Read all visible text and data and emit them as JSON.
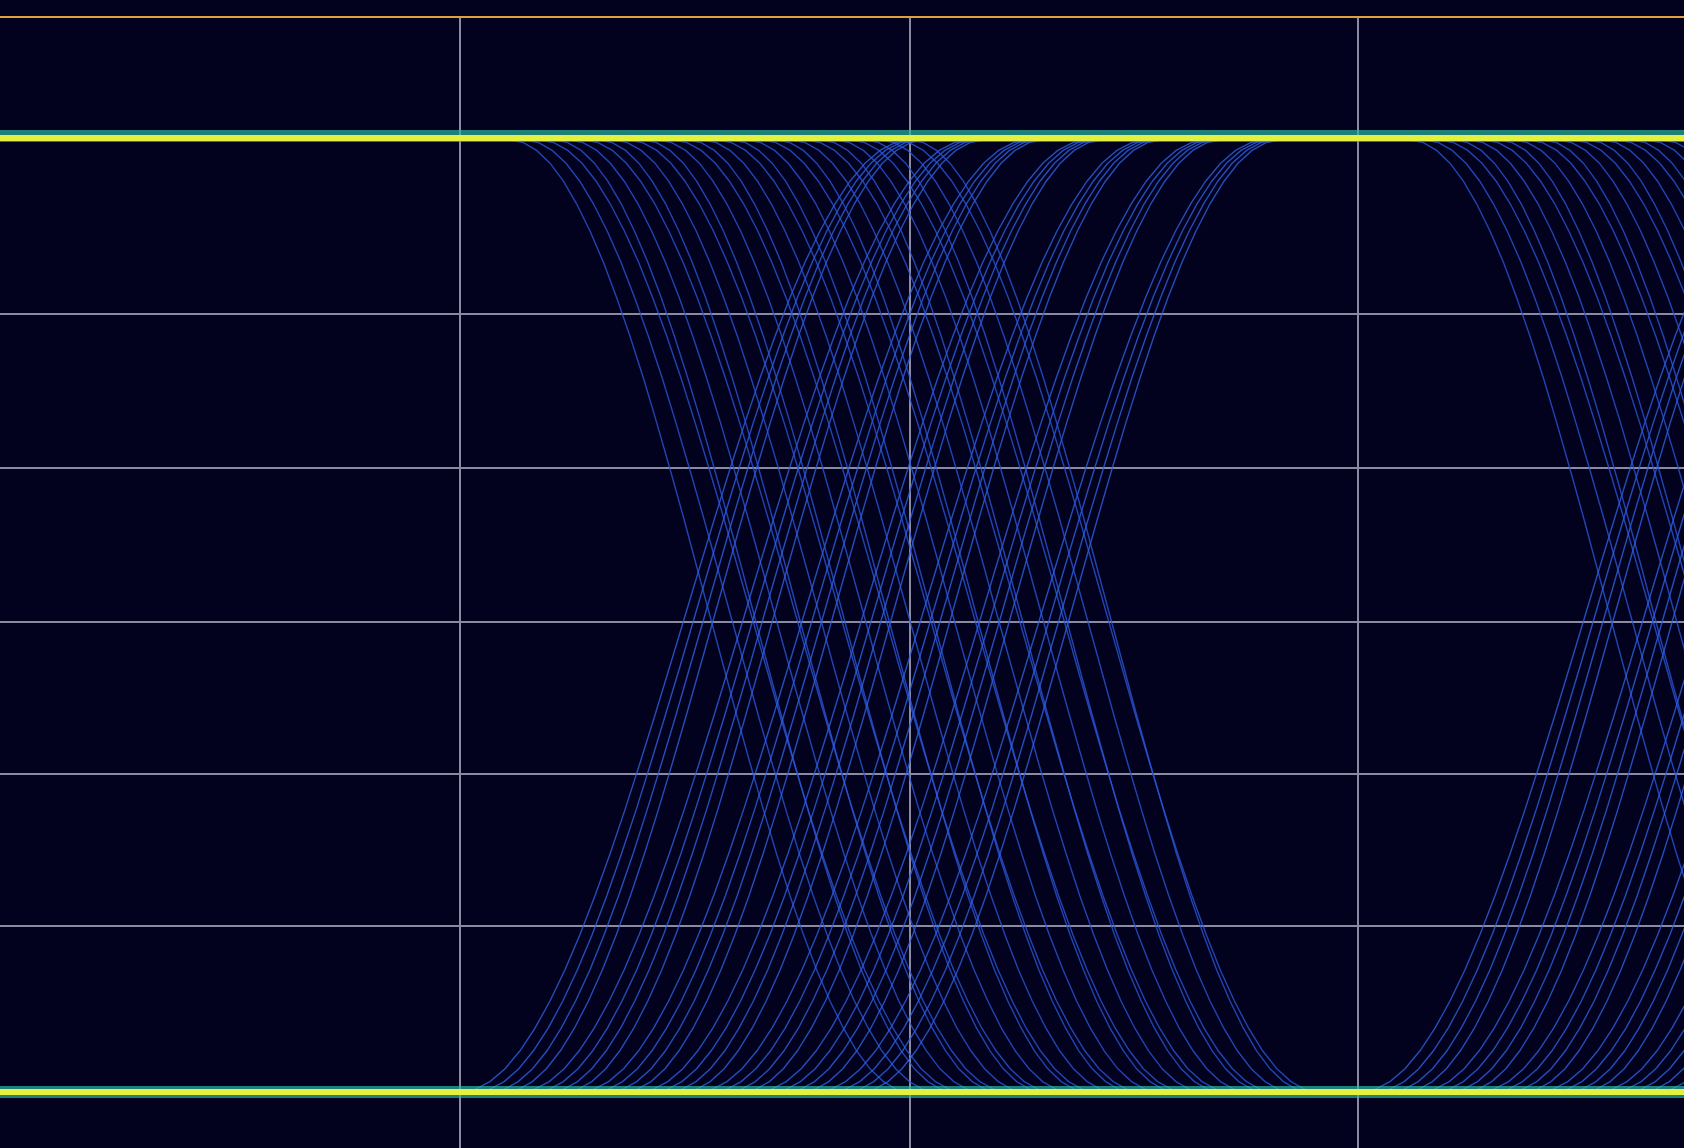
{
  "scope": {
    "eye_pattern": true
  }
}
